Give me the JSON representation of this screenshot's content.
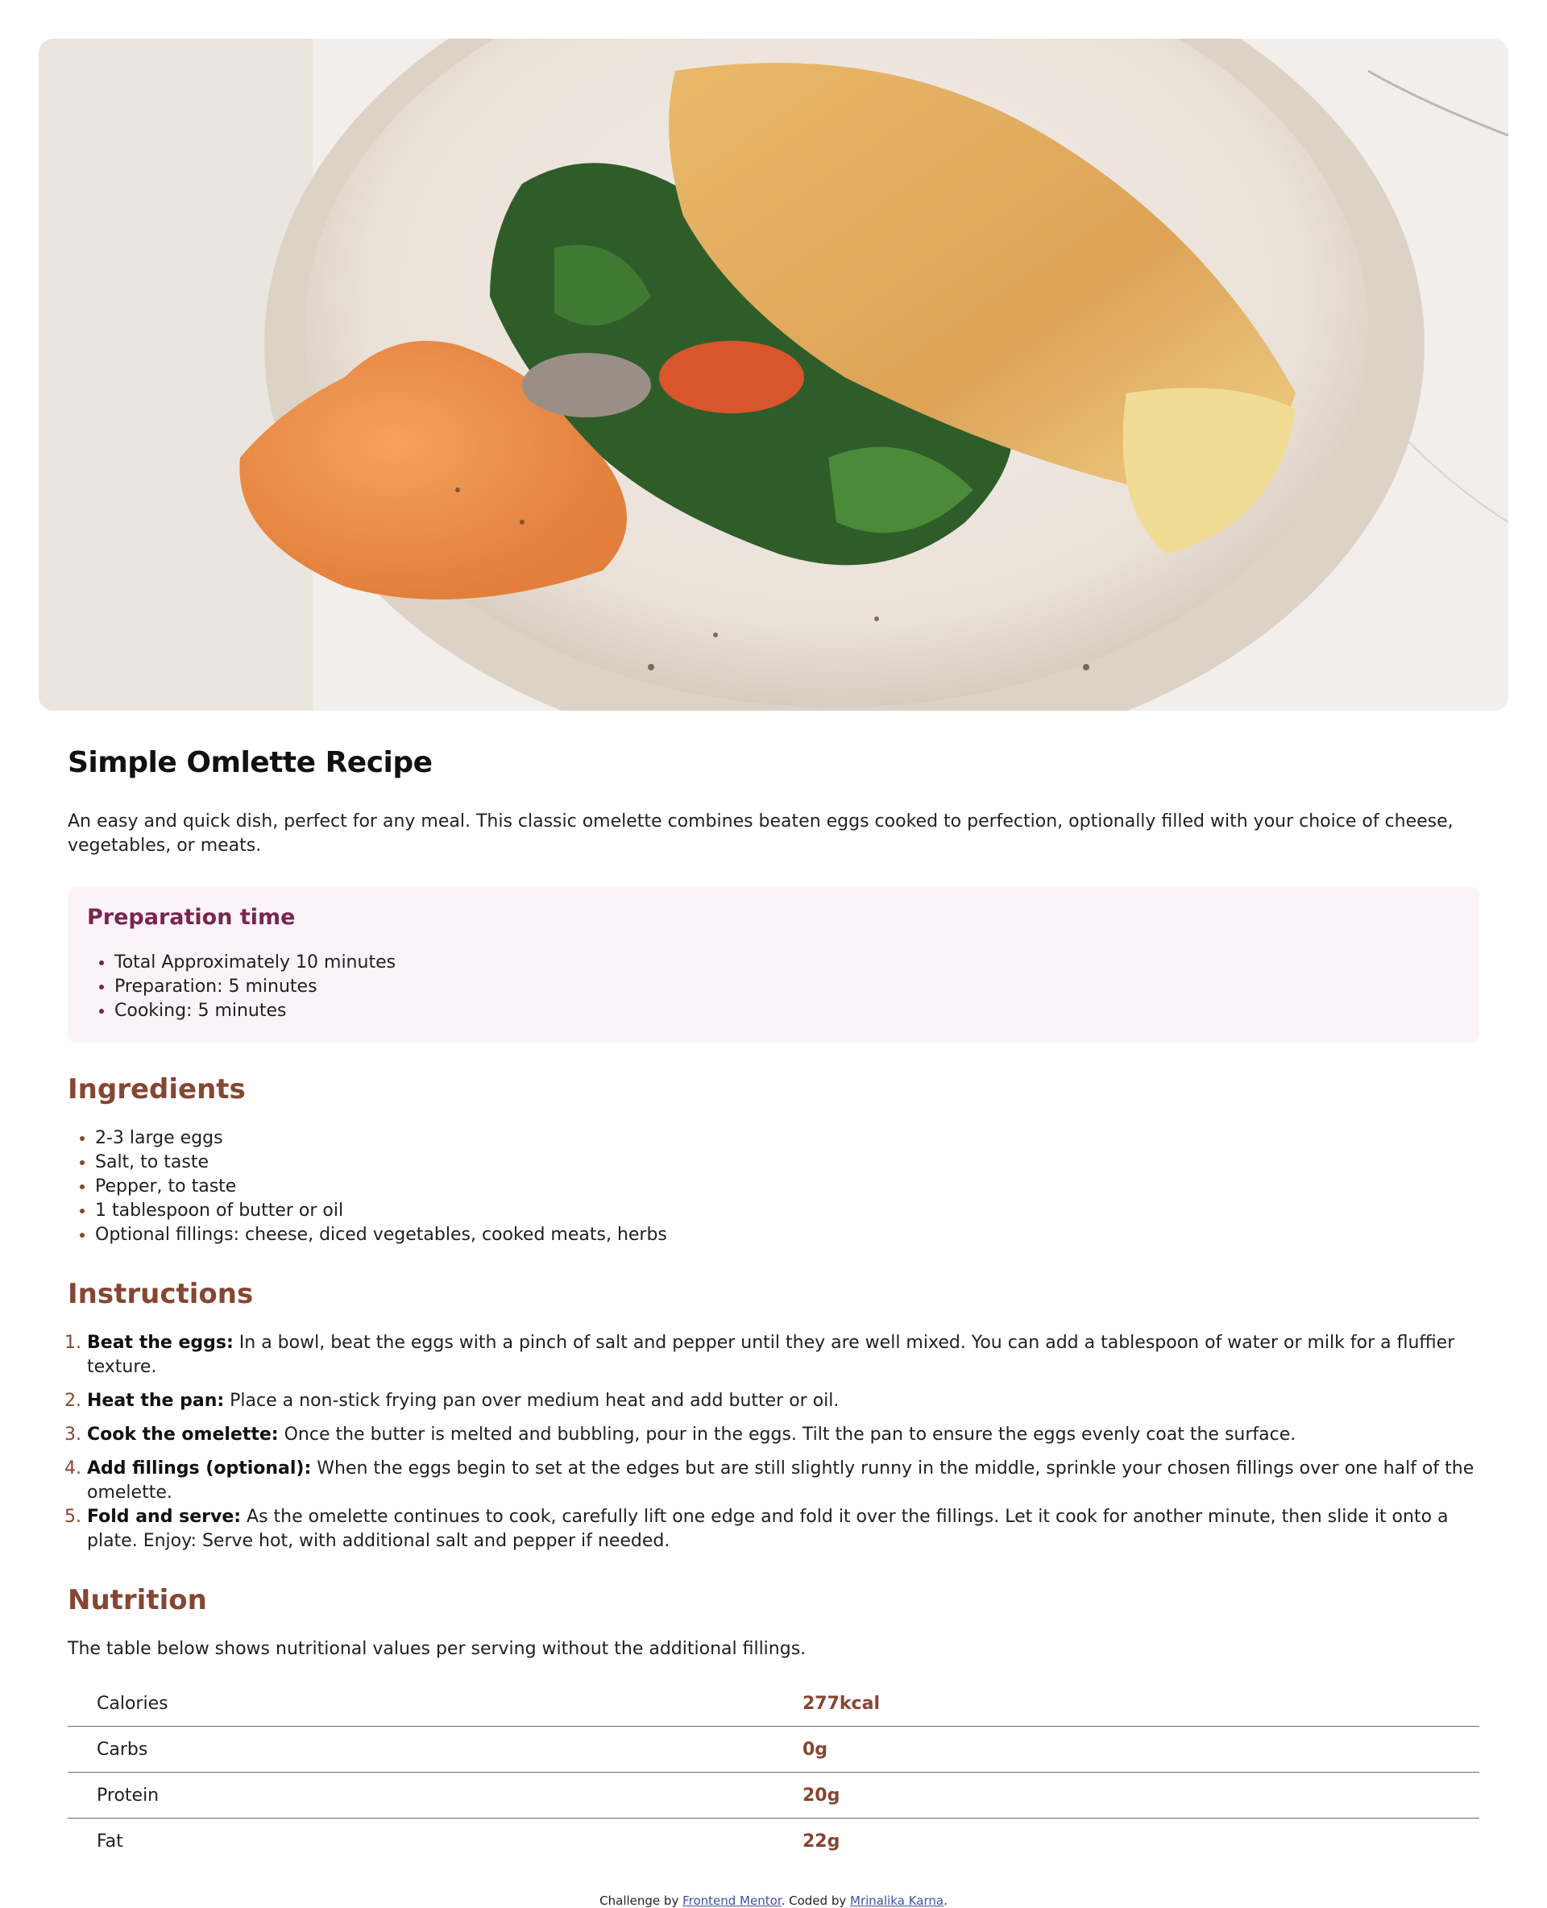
{
  "recipe": {
    "title": "Simple Omlette Recipe",
    "description": "An easy and quick dish, perfect for any meal. This classic omelette combines beaten eggs cooked to perfection, optionally filled with your choice of cheese, vegetables, or meats."
  },
  "preparation": {
    "heading": "Preparation time",
    "items": [
      "Total Approximately 10 minutes",
      "Preparation: 5 minutes",
      "Cooking: 5 minutes"
    ]
  },
  "ingredients": {
    "heading": "Ingredients",
    "items": [
      "2-3 large eggs",
      "Salt, to taste",
      "Pepper, to taste",
      "1 tablespoon of butter or oil",
      "Optional fillings: cheese, diced vegetables, cooked meats, herbs"
    ]
  },
  "instructions": {
    "heading": "Instructions",
    "steps": [
      {
        "title": "Beat the eggs:",
        "text": " In a bowl, beat the eggs with a pinch of salt and pepper until they are well mixed. You can add a tablespoon of water or milk for a fluffier texture."
      },
      {
        "title": "Heat the pan:",
        "text": " Place a non-stick frying pan over medium heat and add butter or oil."
      },
      {
        "title": "Cook the omelette:",
        "text": " Once the butter is melted and bubbling, pour in the eggs. Tilt the pan to ensure the eggs evenly coat the surface."
      },
      {
        "title": "Add fillings (optional):",
        "text": " When the eggs begin to set at the edges but are still slightly runny in the middle, sprinkle your chosen fillings over one half of the omelette."
      },
      {
        "title": "Fold and serve:",
        "text": " As the omelette continues to cook, carefully lift one edge and fold it over the fillings. Let it cook for another minute, then slide it onto a plate. Enjoy: Serve hot, with additional salt and pepper if needed."
      }
    ]
  },
  "nutrition": {
    "heading": "Nutrition",
    "note": "The table below shows nutritional values per serving without the additional fillings.",
    "rows": [
      {
        "label": "Calories",
        "value": "277kcal"
      },
      {
        "label": "Carbs",
        "value": "0g"
      },
      {
        "label": "Protein",
        "value": "20g"
      },
      {
        "label": "Fat",
        "value": "22g"
      }
    ]
  },
  "footer": {
    "prefix": "Challenge by ",
    "link1": "Frontend Mentor",
    "middle": ". Coded by ",
    "link2": "Mrinalika Karna",
    "suffix": "."
  },
  "colors": {
    "accent_brown": "#854632",
    "accent_plum": "#7a2450",
    "prep_bg": "#fcf3f8",
    "link": "#3e52a3"
  }
}
